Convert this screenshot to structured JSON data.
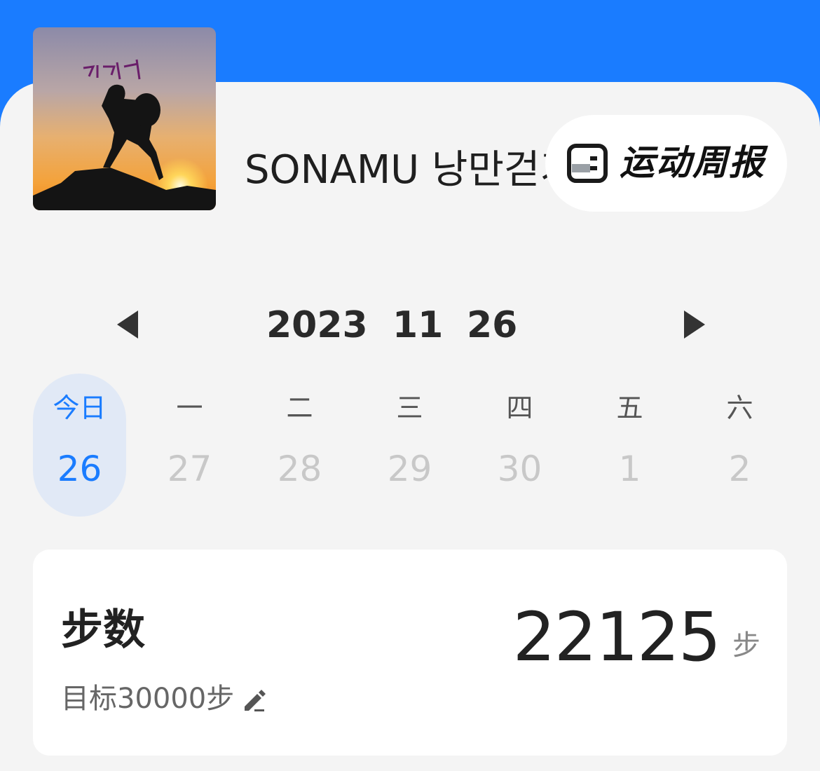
{
  "profile": {
    "avatar_text": "낭만걷기",
    "username": "SONAMU 낭만걷기"
  },
  "weekly_report": {
    "label": "运动周报",
    "icon": "report-icon"
  },
  "date_nav": {
    "prev_icon": "triangle-left-icon",
    "next_icon": "triangle-right-icon",
    "year": "2023",
    "month": "11",
    "day": "26"
  },
  "week": [
    {
      "label": "今日",
      "date": "26",
      "selected": true
    },
    {
      "label": "一",
      "date": "27"
    },
    {
      "label": "二",
      "date": "28"
    },
    {
      "label": "三",
      "date": "29"
    },
    {
      "label": "四",
      "date": "30"
    },
    {
      "label": "五",
      "date": "1"
    },
    {
      "label": "六",
      "date": "2"
    }
  ],
  "steps": {
    "title": "步数",
    "value": "22125",
    "unit": "步",
    "goal": "目标30000步",
    "edit_icon": "pencil-icon"
  },
  "colors": {
    "accent": "#1a7cff",
    "background": "#f4f4f4",
    "selected_bg": "#e1e9f6"
  }
}
